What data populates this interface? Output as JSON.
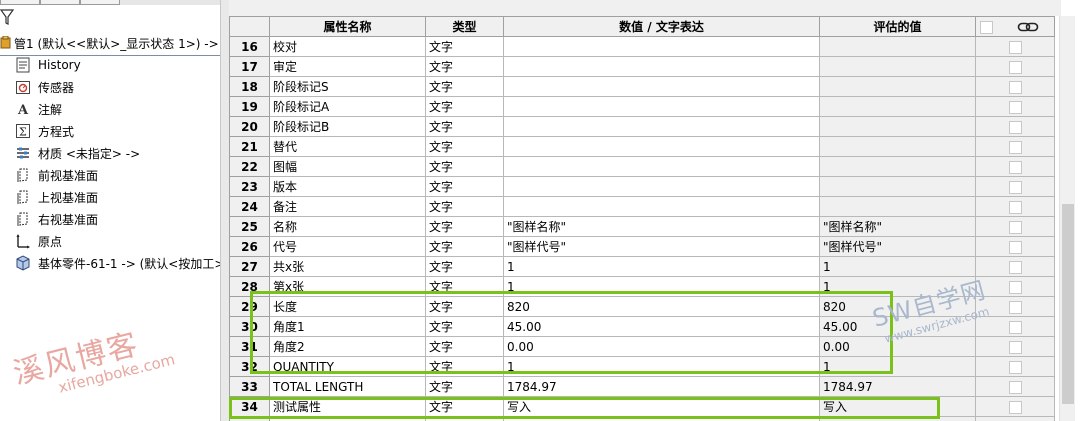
{
  "tree": {
    "root_label": "管1 (默认<<默认>_显示状态 1>) ->",
    "items": [
      {
        "label": "History",
        "icon": "history-icon"
      },
      {
        "label": "传感器",
        "icon": "sensor-icon"
      },
      {
        "label": "注解",
        "icon": "annotations-icon"
      },
      {
        "label": "方程式",
        "icon": "equations-icon"
      },
      {
        "label": "材质 <未指定> ->",
        "icon": "material-icon"
      },
      {
        "label": "前视基准面",
        "icon": "plane-icon"
      },
      {
        "label": "上视基准面",
        "icon": "plane-icon"
      },
      {
        "label": "右视基准面",
        "icon": "plane-icon"
      },
      {
        "label": "原点",
        "icon": "origin-icon"
      },
      {
        "label": "基体零件-61-1 -> (默认<按加工>",
        "icon": "part-icon"
      }
    ]
  },
  "grid": {
    "headers": {
      "name": "属性名称",
      "type": "类型",
      "value": "数值 / 文字表达",
      "evaluated": "评估的值"
    },
    "rows": [
      {
        "num": "16",
        "name": "校对",
        "type": "文字",
        "value": "",
        "evaluated": ""
      },
      {
        "num": "17",
        "name": "审定",
        "type": "文字",
        "value": "",
        "evaluated": ""
      },
      {
        "num": "18",
        "name": "阶段标记S",
        "type": "文字",
        "value": "",
        "evaluated": ""
      },
      {
        "num": "19",
        "name": "阶段标记A",
        "type": "文字",
        "value": "",
        "evaluated": ""
      },
      {
        "num": "20",
        "name": "阶段标记B",
        "type": "文字",
        "value": "",
        "evaluated": ""
      },
      {
        "num": "21",
        "name": "替代",
        "type": "文字",
        "value": "",
        "evaluated": ""
      },
      {
        "num": "22",
        "name": "图幅",
        "type": "文字",
        "value": "",
        "evaluated": ""
      },
      {
        "num": "23",
        "name": "版本",
        "type": "文字",
        "value": "",
        "evaluated": ""
      },
      {
        "num": "24",
        "name": "备注",
        "type": "文字",
        "value": "",
        "evaluated": ""
      },
      {
        "num": "25",
        "name": "名称",
        "type": "文字",
        "value": "\"图样名称\"",
        "evaluated": "\"图样名称\""
      },
      {
        "num": "26",
        "name": "代号",
        "type": "文字",
        "value": "\"图样代号\"",
        "evaluated": "\"图样代号\""
      },
      {
        "num": "27",
        "name": "共x张",
        "type": "文字",
        "value": "1",
        "evaluated": "1"
      },
      {
        "num": "28",
        "name": "第x张",
        "type": "文字",
        "value": "1",
        "evaluated": "1"
      },
      {
        "num": "29",
        "name": "长度",
        "type": "文字",
        "value": "820",
        "evaluated": "820"
      },
      {
        "num": "30",
        "name": "角度1",
        "type": "文字",
        "value": "45.00",
        "evaluated": "45.00"
      },
      {
        "num": "31",
        "name": "角度2",
        "type": "文字",
        "value": "0.00",
        "evaluated": "0.00"
      },
      {
        "num": "32",
        "name": "QUANTITY",
        "type": "文字",
        "value": "1",
        "evaluated": "1"
      },
      {
        "num": "33",
        "name": "TOTAL LENGTH",
        "type": "文字",
        "value": "1784.97",
        "evaluated": "1784.97"
      },
      {
        "num": "34",
        "name": "测试属性",
        "type": "文字",
        "value": "写入",
        "evaluated": "写入"
      },
      {
        "num": "35",
        "name": "",
        "type": "",
        "value": "",
        "evaluated": ""
      }
    ]
  },
  "watermarks": {
    "left_cn": "溪风博客",
    "left_url": "xifengboke.com",
    "right_cn": "SW自学网",
    "right_url": "www.swrjzxw.com"
  },
  "colors": {
    "highlight": "#7ac11a",
    "header_bg": "#f0f0f0",
    "wm_red": "#e8a7a0",
    "wm_blue": "#a9b8cc"
  }
}
